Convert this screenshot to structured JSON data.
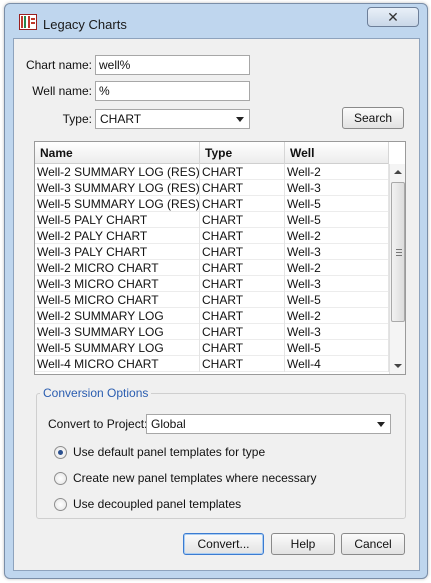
{
  "window": {
    "title": "Legacy Charts",
    "close_glyph": "✕",
    "app_icon": "legacy-charts-icon"
  },
  "form": {
    "chart_name_label": "Chart name:",
    "chart_name_value": "well%",
    "well_name_label": "Well name:",
    "well_name_value": "%",
    "type_label": "Type:",
    "type_value": "CHART",
    "search_label": "Search"
  },
  "table": {
    "columns": [
      "Name",
      "Type",
      "Well"
    ],
    "rows": [
      [
        "Well-2 SUMMARY LOG (RES)",
        "CHART",
        "Well-2"
      ],
      [
        "Well-3 SUMMARY LOG (RES)",
        "CHART",
        "Well-3"
      ],
      [
        "Well-5 SUMMARY LOG (RES)",
        "CHART",
        "Well-5"
      ],
      [
        "Well-5 PALY CHART",
        "CHART",
        "Well-5"
      ],
      [
        "Well-2 PALY CHART",
        "CHART",
        "Well-2"
      ],
      [
        "Well-3 PALY CHART",
        "CHART",
        "Well-3"
      ],
      [
        "Well-2 MICRO CHART",
        "CHART",
        "Well-2"
      ],
      [
        "Well-3 MICRO CHART",
        "CHART",
        "Well-3"
      ],
      [
        "Well-5 MICRO CHART",
        "CHART",
        "Well-5"
      ],
      [
        "Well-2 SUMMARY LOG",
        "CHART",
        "Well-2"
      ],
      [
        "Well-3 SUMMARY LOG",
        "CHART",
        "Well-3"
      ],
      [
        "Well-5 SUMMARY LOG",
        "CHART",
        "Well-5"
      ],
      [
        "Well-4 MICRO CHART",
        "CHART",
        "Well-4"
      ]
    ]
  },
  "conversion": {
    "group_title": "Conversion Options",
    "project_label": "Convert to Project:",
    "project_value": "Global",
    "options": [
      {
        "label": "Use default panel templates for type",
        "checked": true
      },
      {
        "label": "Create new panel templates where necessary",
        "checked": false
      },
      {
        "label": "Use decoupled panel templates",
        "checked": false
      }
    ]
  },
  "buttons": {
    "convert": "Convert...",
    "help": "Help",
    "cancel": "Cancel"
  },
  "colors": {
    "title_bar": "#bfd6ee",
    "group_title": "#2a5db0",
    "default_button_border": "#3b7bd1"
  }
}
